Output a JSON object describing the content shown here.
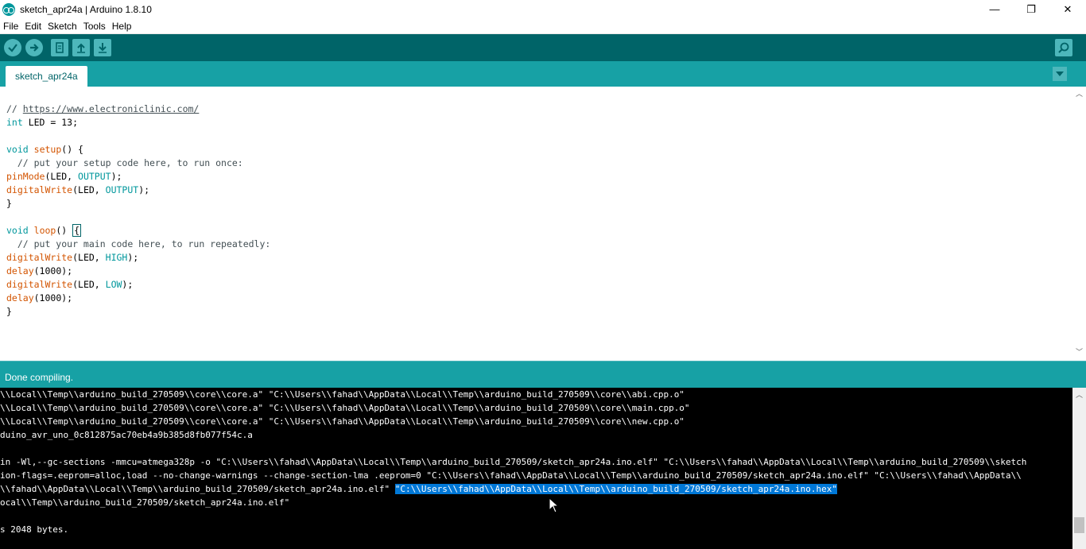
{
  "window": {
    "title": "sketch_apr24a | Arduino 1.8.10",
    "minimize": "—",
    "maximize": "❐",
    "close": "✕"
  },
  "menu": [
    "File",
    "Edit",
    "Sketch",
    "Tools",
    "Help"
  ],
  "toolbar": {
    "verify": "✓",
    "upload": "→",
    "new": "▤",
    "open": "↑",
    "save": "↓",
    "serial": "⌕"
  },
  "tabs": [
    {
      "label": "sketch_apr24a"
    }
  ],
  "tab_menu_glyph": "▼",
  "editor": {
    "lines": [
      {
        "parts": [
          {
            "t": "// ",
            "c": "cm"
          },
          {
            "t": "https://www.electroniclinic.com/",
            "c": "lk"
          }
        ]
      },
      {
        "parts": [
          {
            "t": "int",
            "c": "kw"
          },
          {
            "t": " LED = 13;",
            "c": ""
          }
        ]
      },
      {
        "parts": []
      },
      {
        "parts": [
          {
            "t": "void",
            "c": "kw"
          },
          {
            "t": " ",
            "c": ""
          },
          {
            "t": "setup",
            "c": "fn"
          },
          {
            "t": "() {",
            "c": ""
          }
        ]
      },
      {
        "parts": [
          {
            "t": "  // put your setup code here, to run once:",
            "c": "cm"
          }
        ]
      },
      {
        "parts": [
          {
            "t": "pinMode",
            "c": "fn"
          },
          {
            "t": "(LED, ",
            "c": ""
          },
          {
            "t": "OUTPUT",
            "c": "kw"
          },
          {
            "t": ");",
            "c": ""
          }
        ]
      },
      {
        "parts": [
          {
            "t": "digitalWrite",
            "c": "fn"
          },
          {
            "t": "(LED, ",
            "c": ""
          },
          {
            "t": "OUTPUT",
            "c": "kw"
          },
          {
            "t": ");",
            "c": ""
          }
        ]
      },
      {
        "parts": [
          {
            "t": "}",
            "c": ""
          }
        ]
      },
      {
        "parts": []
      },
      {
        "parts": [
          {
            "t": "void",
            "c": "kw"
          },
          {
            "t": " ",
            "c": ""
          },
          {
            "t": "loop",
            "c": "fn"
          },
          {
            "t": "() ",
            "c": ""
          },
          {
            "t": "{",
            "c": "cursor"
          }
        ]
      },
      {
        "parts": [
          {
            "t": "  // put your main code here, to run repeatedly:",
            "c": "cm"
          }
        ]
      },
      {
        "parts": [
          {
            "t": "digitalWrite",
            "c": "fn"
          },
          {
            "t": "(LED, ",
            "c": ""
          },
          {
            "t": "HIGH",
            "c": "kw"
          },
          {
            "t": ");",
            "c": ""
          }
        ]
      },
      {
        "parts": [
          {
            "t": "delay",
            "c": "fn"
          },
          {
            "t": "(1000);",
            "c": ""
          }
        ]
      },
      {
        "parts": [
          {
            "t": "digitalWrite",
            "c": "fn"
          },
          {
            "t": "(LED, ",
            "c": ""
          },
          {
            "t": "LOW",
            "c": "kw"
          },
          {
            "t": ");",
            "c": ""
          }
        ]
      },
      {
        "parts": [
          {
            "t": "delay",
            "c": "fn"
          },
          {
            "t": "(1000);",
            "c": ""
          }
        ]
      },
      {
        "parts": [
          {
            "t": "}",
            "c": ""
          }
        ]
      }
    ]
  },
  "status": {
    "message": "Done compiling."
  },
  "console": {
    "lines": [
      {
        "text": "\\\\Local\\\\Temp\\\\arduino_build_270509\\\\core\\\\core.a\" \"C:\\\\Users\\\\fahad\\\\AppData\\\\Local\\\\Temp\\\\arduino_build_270509\\\\core\\\\abi.cpp.o\""
      },
      {
        "text": "\\\\Local\\\\Temp\\\\arduino_build_270509\\\\core\\\\core.a\" \"C:\\\\Users\\\\fahad\\\\AppData\\\\Local\\\\Temp\\\\arduino_build_270509\\\\core\\\\main.cpp.o\""
      },
      {
        "text": "\\\\Local\\\\Temp\\\\arduino_build_270509\\\\core\\\\core.a\" \"C:\\\\Users\\\\fahad\\\\AppData\\\\Local\\\\Temp\\\\arduino_build_270509\\\\core\\\\new.cpp.o\""
      },
      {
        "text": "duino_avr_uno_0c812875ac70eb4a9b385d8fb077f54c.a"
      },
      {
        "text": ""
      },
      {
        "text": "in -Wl,--gc-sections -mmcu=atmega328p -o \"C:\\\\Users\\\\fahad\\\\AppData\\\\Local\\\\Temp\\\\arduino_build_270509/sketch_apr24a.ino.elf\" \"C:\\\\Users\\\\fahad\\\\AppData\\\\Local\\\\Temp\\\\arduino_build_270509\\\\sketch"
      },
      {
        "text": "ion-flags=.eeprom=alloc,load --no-change-warnings --change-section-lma .eeprom=0 \"C:\\\\Users\\\\fahad\\\\AppData\\\\Local\\\\Temp\\\\arduino_build_270509/sketch_apr24a.ino.elf\" \"C:\\\\Users\\\\fahad\\\\AppData\\\\"
      },
      {
        "text": "\\\\fahad\\\\AppData\\\\Local\\\\Temp\\\\arduino_build_270509/sketch_apr24a.ino.elf\" ",
        "selected": "\"C:\\\\Users\\\\fahad\\\\AppData\\\\Local\\\\Temp\\\\arduino_build_270509/sketch_apr24a.ino.hex\""
      },
      {
        "text": "ocal\\\\Temp\\\\arduino_build_270509/sketch_apr24a.ino.elf\""
      },
      {
        "text": ""
      },
      {
        "text": "s 2048 bytes."
      }
    ]
  },
  "colors": {
    "toolbar_bg": "#006468",
    "tab_bar_bg": "#17a1a5",
    "button_bg": "#4db7bb",
    "console_bg": "#000000",
    "selection": "#0078d7"
  }
}
